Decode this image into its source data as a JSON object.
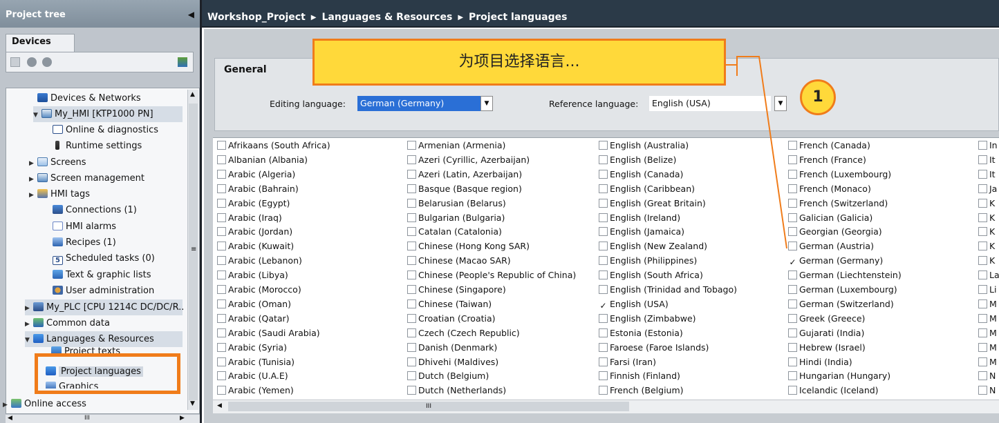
{
  "tree": {
    "title": "Project tree",
    "tab": "Devices",
    "items": [
      {
        "label": "Devices & Networks",
        "icon": "network-icon"
      },
      {
        "label": "My_HMI [KTP1000 PN]",
        "icon": "hmi-device-icon"
      },
      {
        "label": "Online & diagnostics",
        "icon": "diagnostics-icon"
      },
      {
        "label": "Runtime settings",
        "icon": "runtime-settings-icon"
      },
      {
        "label": "Screens",
        "icon": "folder-icon"
      },
      {
        "label": "Screen management",
        "icon": "screen-management-icon"
      },
      {
        "label": "HMI tags",
        "icon": "hmi-tags-icon"
      },
      {
        "label": "Connections (1)",
        "icon": "connections-icon"
      },
      {
        "label": "HMI alarms",
        "icon": "alarms-icon"
      },
      {
        "label": "Recipes (1)",
        "icon": "recipes-icon"
      },
      {
        "label": "Scheduled tasks (0)",
        "icon": "scheduled-tasks-icon"
      },
      {
        "label": "Text & graphic lists",
        "icon": "text-lists-icon"
      },
      {
        "label": "User administration",
        "icon": "user-admin-icon"
      },
      {
        "label": "My_PLC [CPU 1214C DC/DC/R..",
        "icon": "plc-icon"
      },
      {
        "label": "Common data",
        "icon": "common-data-icon"
      },
      {
        "label": "Languages & Resources",
        "icon": "languages-icon"
      },
      {
        "label": "Project texts",
        "icon": "project-texts-icon"
      },
      {
        "label": "Project languages",
        "icon": "project-languages-icon"
      },
      {
        "label": "Graphics",
        "icon": "graphics-icon"
      },
      {
        "label": "Online access",
        "icon": "online-access-icon"
      }
    ]
  },
  "path": {
    "parts": [
      "Workshop_Project",
      "Languages & Resources",
      "Project languages"
    ]
  },
  "general": {
    "title": "General",
    "editing_label": "Editing language:",
    "editing_value": "German (Germany)",
    "reference_label": "Reference language:",
    "reference_value": "English (USA)"
  },
  "callout": {
    "text": "为项目选择语言...",
    "badge": "1"
  },
  "accent": "#f07c1a",
  "callout_fill": "#ffd93a",
  "languages": {
    "col1": [
      {
        "label": "Afrikaans (South Africa)",
        "checked": false
      },
      {
        "label": "Albanian (Albania)",
        "checked": false
      },
      {
        "label": "Arabic (Algeria)",
        "checked": false
      },
      {
        "label": "Arabic (Bahrain)",
        "checked": false
      },
      {
        "label": "Arabic (Egypt)",
        "checked": false
      },
      {
        "label": "Arabic (Iraq)",
        "checked": false
      },
      {
        "label": "Arabic (Jordan)",
        "checked": false
      },
      {
        "label": "Arabic (Kuwait)",
        "checked": false
      },
      {
        "label": "Arabic (Lebanon)",
        "checked": false
      },
      {
        "label": "Arabic (Libya)",
        "checked": false
      },
      {
        "label": "Arabic (Morocco)",
        "checked": false
      },
      {
        "label": "Arabic (Oman)",
        "checked": false
      },
      {
        "label": "Arabic (Qatar)",
        "checked": false
      },
      {
        "label": "Arabic (Saudi Arabia)",
        "checked": false
      },
      {
        "label": "Arabic (Syria)",
        "checked": false
      },
      {
        "label": "Arabic (Tunisia)",
        "checked": false
      },
      {
        "label": "Arabic (U.A.E)",
        "checked": false
      },
      {
        "label": "Arabic (Yemen)",
        "checked": false
      }
    ],
    "col2": [
      {
        "label": "Armenian (Armenia)",
        "checked": false
      },
      {
        "label": "Azeri (Cyrillic, Azerbaijan)",
        "checked": false
      },
      {
        "label": "Azeri (Latin, Azerbaijan)",
        "checked": false
      },
      {
        "label": "Basque (Basque region)",
        "checked": false
      },
      {
        "label": "Belarusian (Belarus)",
        "checked": false
      },
      {
        "label": "Bulgarian (Bulgaria)",
        "checked": false
      },
      {
        "label": "Catalan (Catalonia)",
        "checked": false
      },
      {
        "label": "Chinese (Hong Kong SAR)",
        "checked": false
      },
      {
        "label": "Chinese (Macao SAR)",
        "checked": false
      },
      {
        "label": "Chinese (People's Republic of China)",
        "checked": false
      },
      {
        "label": "Chinese (Singapore)",
        "checked": false
      },
      {
        "label": "Chinese (Taiwan)",
        "checked": false
      },
      {
        "label": "Croatian (Croatia)",
        "checked": false
      },
      {
        "label": "Czech (Czech Republic)",
        "checked": false
      },
      {
        "label": "Danish (Denmark)",
        "checked": false
      },
      {
        "label": "Dhivehi (Maldives)",
        "checked": false
      },
      {
        "label": "Dutch (Belgium)",
        "checked": false
      },
      {
        "label": "Dutch (Netherlands)",
        "checked": false
      }
    ],
    "col3": [
      {
        "label": "English (Australia)",
        "checked": false
      },
      {
        "label": "English (Belize)",
        "checked": false
      },
      {
        "label": "English (Canada)",
        "checked": false
      },
      {
        "label": "English (Caribbean)",
        "checked": false
      },
      {
        "label": "English (Great Britain)",
        "checked": false
      },
      {
        "label": "English (Ireland)",
        "checked": false
      },
      {
        "label": "English (Jamaica)",
        "checked": false
      },
      {
        "label": "English (New Zealand)",
        "checked": false
      },
      {
        "label": "English (Philippines)",
        "checked": false
      },
      {
        "label": "English (South Africa)",
        "checked": false
      },
      {
        "label": "English (Trinidad and Tobago)",
        "checked": false
      },
      {
        "label": "English (USA)",
        "checked": true
      },
      {
        "label": "English (Zimbabwe)",
        "checked": false
      },
      {
        "label": "Estonia (Estonia)",
        "checked": false
      },
      {
        "label": "Faroese (Faroe Islands)",
        "checked": false
      },
      {
        "label": "Farsi (Iran)",
        "checked": false
      },
      {
        "label": "Finnish (Finland)",
        "checked": false
      },
      {
        "label": "French (Belgium)",
        "checked": false
      }
    ],
    "col4": [
      {
        "label": "French (Canada)",
        "checked": false
      },
      {
        "label": "French (France)",
        "checked": false
      },
      {
        "label": "French (Luxembourg)",
        "checked": false
      },
      {
        "label": "French (Monaco)",
        "checked": false
      },
      {
        "label": "French (Switzerland)",
        "checked": false
      },
      {
        "label": "Galician (Galicia)",
        "checked": false
      },
      {
        "label": "Georgian (Georgia)",
        "checked": false
      },
      {
        "label": "German (Austria)",
        "checked": false
      },
      {
        "label": "German (Germany)",
        "checked": true
      },
      {
        "label": "German (Liechtenstein)",
        "checked": false
      },
      {
        "label": "German (Luxembourg)",
        "checked": false
      },
      {
        "label": "German (Switzerland)",
        "checked": false
      },
      {
        "label": "Greek (Greece)",
        "checked": false
      },
      {
        "label": "Gujarati (India)",
        "checked": false
      },
      {
        "label": "Hebrew (Israel)",
        "checked": false
      },
      {
        "label": "Hindi (India)",
        "checked": false
      },
      {
        "label": "Hungarian (Hungary)",
        "checked": false
      },
      {
        "label": "Icelandic (Iceland)",
        "checked": false
      }
    ],
    "col5": [
      {
        "label": "In",
        "checked": false
      },
      {
        "label": "It",
        "checked": false
      },
      {
        "label": "It",
        "checked": false
      },
      {
        "label": "Ja",
        "checked": false
      },
      {
        "label": "K",
        "checked": false
      },
      {
        "label": "K",
        "checked": false
      },
      {
        "label": "K",
        "checked": false
      },
      {
        "label": "K",
        "checked": false
      },
      {
        "label": "K",
        "checked": false
      },
      {
        "label": "La",
        "checked": false
      },
      {
        "label": "Li",
        "checked": false
      },
      {
        "label": "M",
        "checked": false
      },
      {
        "label": "M",
        "checked": false
      },
      {
        "label": "M",
        "checked": false
      },
      {
        "label": "M",
        "checked": false
      },
      {
        "label": "M",
        "checked": false
      },
      {
        "label": "N",
        "checked": false
      },
      {
        "label": "N",
        "checked": false
      }
    ]
  }
}
